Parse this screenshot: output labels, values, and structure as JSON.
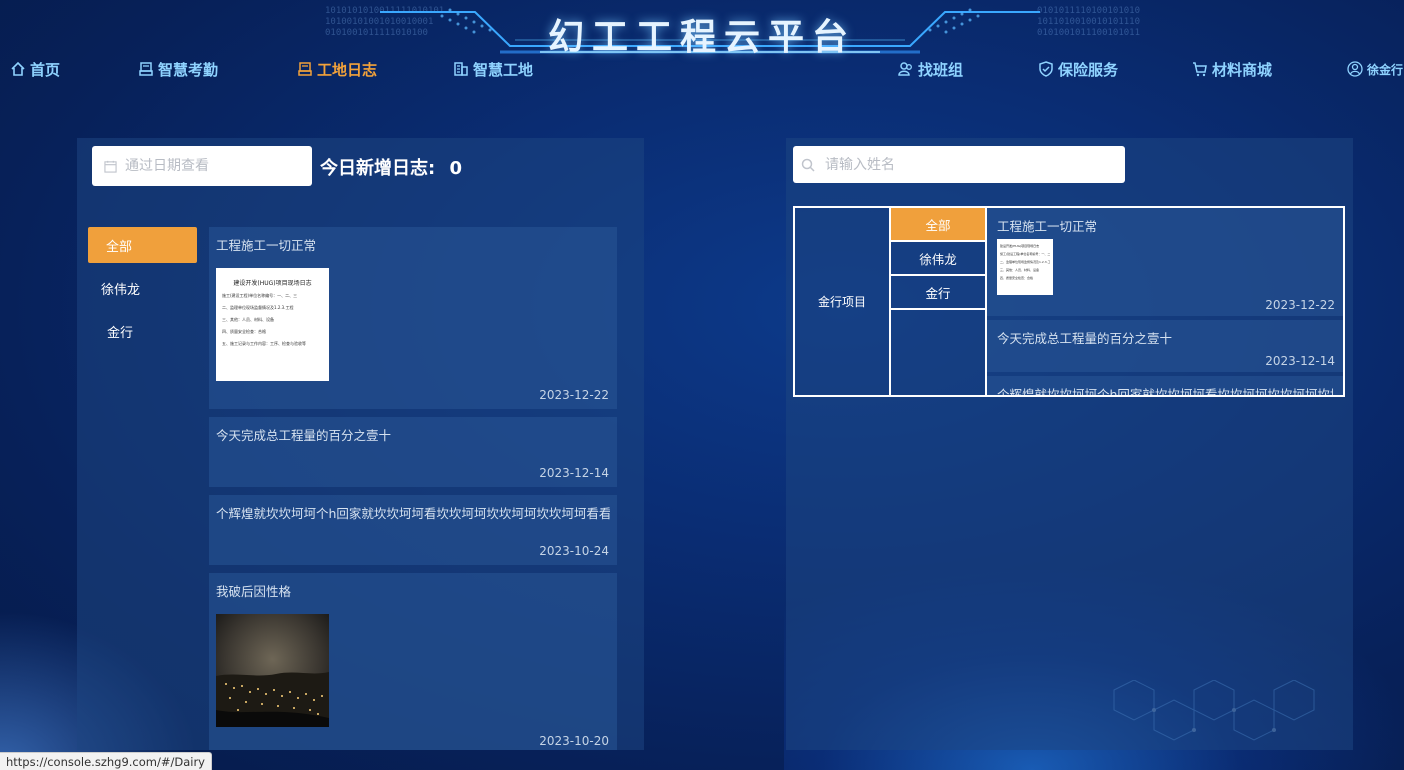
{
  "site_title": "幻工工程云平台",
  "nav": {
    "home": "首页",
    "attendance": "智慧考勤",
    "site_log": "工地日志",
    "smart_site": "智慧工地",
    "find_team": "找班组",
    "insurance": "保险服务",
    "materials": "材料商城",
    "user": "徐金行"
  },
  "left": {
    "date_placeholder": "通过日期查看",
    "today_label": "今日新增日志:",
    "today_count": "0",
    "people": [
      "全部",
      "徐伟龙",
      "金行"
    ],
    "logs": [
      {
        "text": "工程施工一切正常",
        "date": "2023-12-22",
        "image": "document"
      },
      {
        "text": "今天完成总工程量的百分之壹十",
        "date": "2023-12-14"
      },
      {
        "text": "个辉煌就坎坎坷坷个h回家就坎坎坷坷看坎坎坷坷坎坎坷坷坎坎坷坷看看",
        "date": "2023-10-24"
      },
      {
        "text": "我破后因性格",
        "date": "2023-10-20",
        "image": "night-city"
      }
    ],
    "doc_lines": [
      "建设开发(HUG)项目现场日志",
      "施工(建设工程)单位名称编号：一、二、三",
      "二、监理单位现场监督情况及1.2.3.工程",
      "三、其他：人员、材料、设备",
      "四、质量安全检查：合格",
      "五、施工记录与工作内容：工序、检查与验收等"
    ]
  },
  "right": {
    "name_placeholder": "请输入姓名",
    "project": "金行项目",
    "members": [
      "全部",
      "徐伟龙",
      "金行"
    ],
    "logs": [
      {
        "text": "工程施工一切正常",
        "date": "2023-12-22",
        "image": "document"
      },
      {
        "text": "今天完成总工程量的百分之壹十",
        "date": "2023-12-14"
      },
      {
        "text": "个辉煌就坎坎坷坷个h回家就坎坎坷坷看坎坎坷坷坎坎坷坷坎坎坷坷看看",
        "date": ""
      }
    ]
  },
  "status_url": "https://console.szhg9.com/#/Dairy",
  "colors": {
    "accent": "#f0a03c",
    "nav": "#8fd3ff",
    "bg": "#0a2d74"
  }
}
